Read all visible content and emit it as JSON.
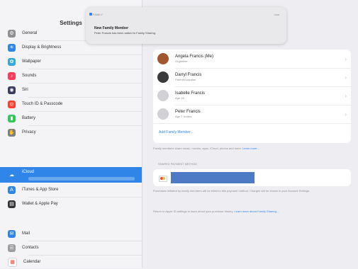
{
  "sidebar": {
    "title": "Settings",
    "items": [
      {
        "label": "General",
        "color": "#8e8e93",
        "glyph": "⚙"
      },
      {
        "label": "Display & Brightness",
        "color": "#2f86e8",
        "glyph": "☀"
      },
      {
        "label": "Wallpaper",
        "color": "#34aadc",
        "glyph": "✿"
      },
      {
        "label": "Sounds",
        "color": "#ff3b5c",
        "glyph": "♪"
      },
      {
        "label": "Siri",
        "color": "#3c3c60",
        "glyph": "◉"
      },
      {
        "label": "Touch ID & Passcode",
        "color": "#ff3b30",
        "glyph": "◎"
      },
      {
        "label": "Battery",
        "color": "#34c759",
        "glyph": "▮"
      },
      {
        "label": "Privacy",
        "color": "#7d7d82",
        "glyph": "✋"
      },
      {
        "label": "iCloud",
        "color": "#2f86e8",
        "glyph": "☁"
      },
      {
        "label": "iTunes & App Store",
        "color": "#2f86e8",
        "glyph": "A"
      },
      {
        "label": "Wallet & Apple Pay",
        "color": "#333333",
        "glyph": "▤"
      },
      {
        "label": "Mail",
        "color": "#2f86e8",
        "glyph": "✉"
      },
      {
        "label": "Contacts",
        "color": "#9c9ca1",
        "glyph": "☰"
      },
      {
        "label": "Calendar",
        "color": "#ffffff",
        "glyph": "▦"
      }
    ]
  },
  "notification": {
    "app": "FAMILY",
    "time": "now",
    "title": "New Family Member",
    "body": "Peter Francis has been added to Family Sharing."
  },
  "family": {
    "members": [
      {
        "name": "Angela Francis (Me)",
        "role": "Organizer",
        "avatar_color": "#a0562e"
      },
      {
        "name": "Darryl Francis",
        "role": "Parent/Guardian",
        "avatar_color": "#3a3a3c"
      },
      {
        "name": "Isabelle Francis",
        "role": "Age 15",
        "avatar_color": "#d1d1d6"
      },
      {
        "name": "Peter Francis",
        "role": "Age 7 Invited",
        "avatar_color": "#d1d1d6"
      }
    ],
    "add_member": "Add Family Member...",
    "footer": "Family members share music, movies, apps, iCloud, photos and more.",
    "learn_more": "Learn more...",
    "payment_header": "SHARED PAYMENT METHOD",
    "payment_note": "Purchases initiated by family members will be billed to this payment method. Charges will be shown in your Account Settings.",
    "bottom_note": "Return to Apple ID settings to learn about your purchase history.",
    "bottom_link": "Learn more about Family Sharing..."
  }
}
